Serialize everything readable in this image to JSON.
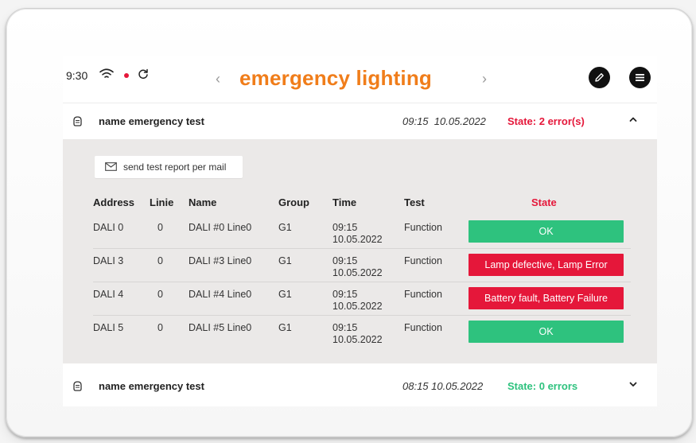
{
  "status_bar": {
    "time": "9:30",
    "icons": [
      "wifi-icon",
      "recording-dot",
      "sync-icon"
    ]
  },
  "header": {
    "title": "emergency lighting",
    "prev_glyph": "‹",
    "next_glyph": "›",
    "actions": [
      "edit-icon",
      "menu-icon"
    ]
  },
  "colors": {
    "accent": "#f07d1a",
    "error": "#e5173a",
    "ok": "#2ec27e",
    "panel_bg": "#ebe9e8"
  },
  "tests": [
    {
      "name": "name emergency test",
      "datetime": "09:15  10.05.2022",
      "state": "State: 2 error(s)",
      "expanded": true
    },
    {
      "name": "name emergency test",
      "datetime": "08:15 10.05.2022",
      "state": "State: 0 errors",
      "expanded": false
    }
  ],
  "report": {
    "mail_button_label": "send test report per mail"
  },
  "table": {
    "headers": {
      "address": "Address",
      "line": "Linie",
      "name": "Name",
      "group": "Group",
      "time": "Time",
      "test": "Test",
      "state": "State"
    },
    "rows": [
      {
        "address": "DALI 0",
        "line": "0",
        "name": "DALI #0 Line0",
        "group": "G1",
        "time": "09:15 10.05.2022",
        "test": "Function",
        "state": "OK",
        "status": "ok"
      },
      {
        "address": "DALI 3",
        "line": "0",
        "name": "DALI #3 Line0",
        "group": "G1",
        "time": "09:15 10.05.2022",
        "test": "Function",
        "state": "Lamp defective, Lamp Error",
        "status": "error"
      },
      {
        "address": "DALI 4",
        "line": "0",
        "name": "DALI #4 Line0",
        "group": "G1",
        "time": "09:15 10.05.2022",
        "test": "Function",
        "state": "Battery fault, Battery Failure",
        "status": "error"
      },
      {
        "address": "DALI 5",
        "line": "0",
        "name": "DALI #5 Line0",
        "group": "G1",
        "time": "09:15 10.05.2022",
        "test": "Function",
        "state": "OK",
        "status": "ok"
      }
    ]
  }
}
